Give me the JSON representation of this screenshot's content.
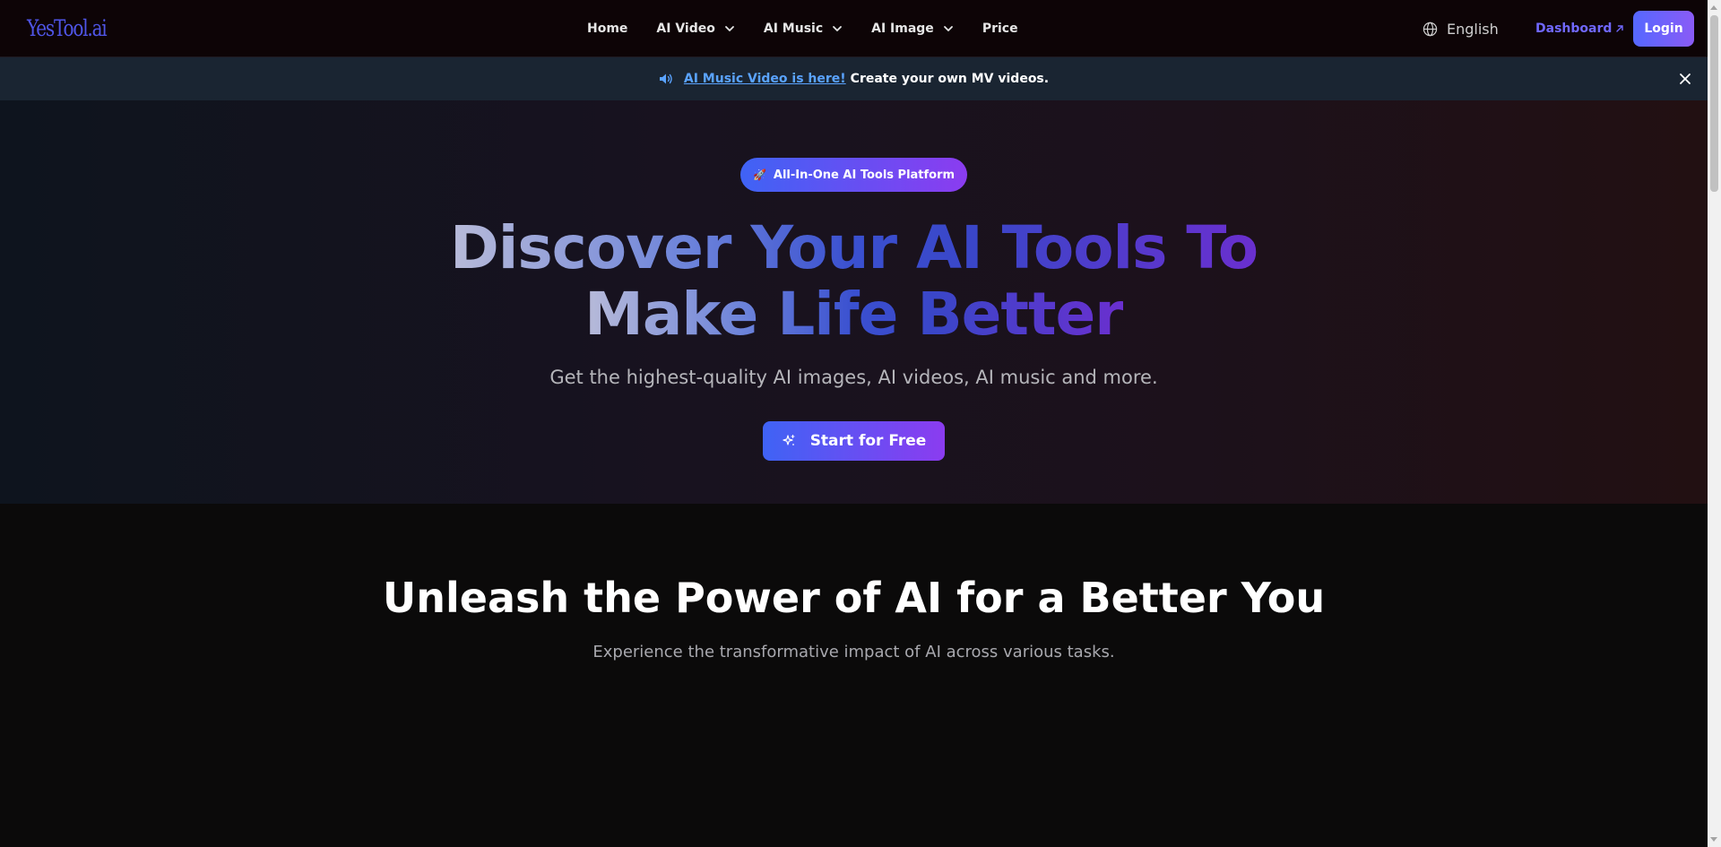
{
  "header": {
    "logo": "YesTool.ai",
    "nav": [
      {
        "label": "Home",
        "has_dropdown": false
      },
      {
        "label": "AI Video",
        "has_dropdown": true
      },
      {
        "label": "AI Music",
        "has_dropdown": true
      },
      {
        "label": "AI Image",
        "has_dropdown": true
      },
      {
        "label": "Price",
        "has_dropdown": false
      }
    ],
    "language": "English",
    "dashboard_label": "Dashboard",
    "login_label": "Login"
  },
  "announcement": {
    "link_text": "AI Music Video is here!",
    "text": "Create your own MV videos."
  },
  "hero": {
    "badge": "All-In-One AI Tools Platform",
    "headline_line1": "Discover Your AI Tools To",
    "headline_line2": "Make Life Better",
    "subtitle": "Get the highest-quality AI images, AI videos, AI music and more.",
    "cta_label": "Start for Free"
  },
  "section": {
    "title": "Unleash the Power of AI for a Better You",
    "subtitle": "Experience the transformative impact of AI across various tasks."
  },
  "icons": {
    "language": "globe-icon",
    "dashboard": "arrow-up-right-icon",
    "announcement": "speaker-icon",
    "close": "close-icon",
    "badge": "rocket-icon",
    "cta": "sparkle-icon",
    "dropdown": "chevron-down-icon"
  },
  "colors": {
    "accent_gradient_start": "#3f63f5",
    "accent_gradient_end": "#8b3cf0",
    "dashboard_link": "#7068ff",
    "announcement_link": "#5aa3ff",
    "announcement_bg": "#1a2532"
  }
}
